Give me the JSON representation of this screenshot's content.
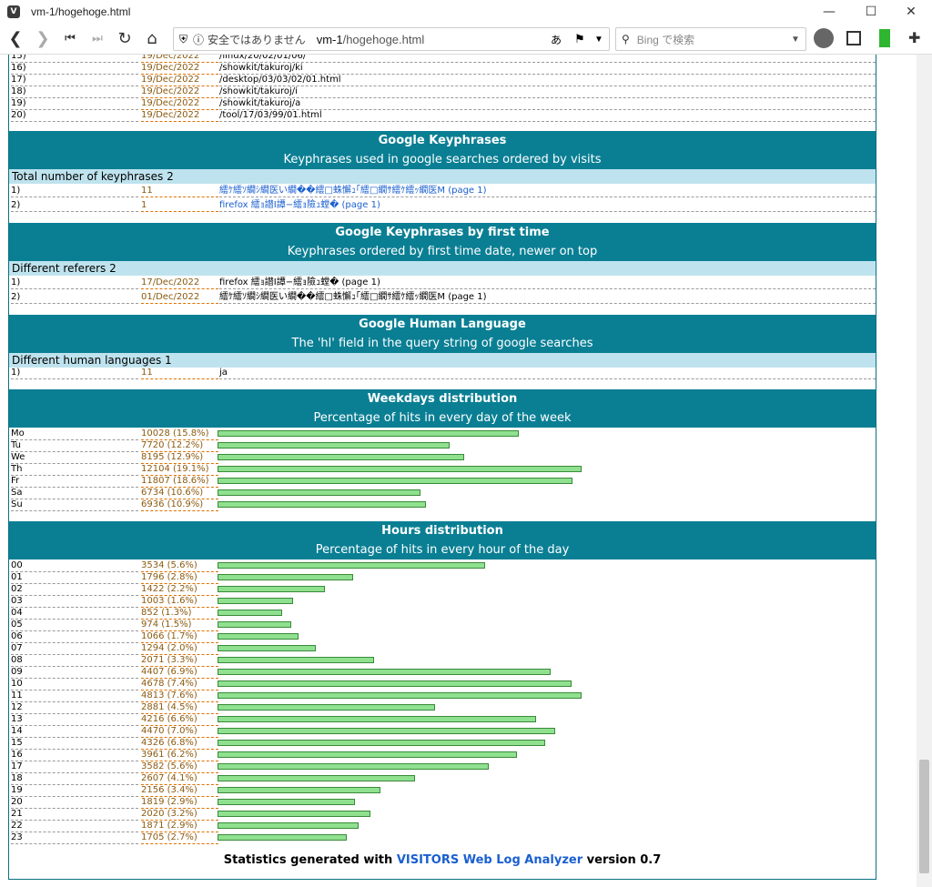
{
  "window": {
    "title": "vm-1/hogehoge.html"
  },
  "address": {
    "security": "安全ではありません",
    "host": "vm-1",
    "path": "/hogehoge.html"
  },
  "search": {
    "placeholder": "Bing で検索"
  },
  "top_rows": [
    {
      "n": "15)",
      "date": "19/Dec/2022",
      "page": "/linux/20/02/01/06/"
    },
    {
      "n": "16)",
      "date": "19/Dec/2022",
      "page": "/showkit/takuroj/ki"
    },
    {
      "n": "17)",
      "date": "19/Dec/2022",
      "page": "/desktop/03/03/02/01.html"
    },
    {
      "n": "18)",
      "date": "19/Dec/2022",
      "page": "/showkit/takuroj/i"
    },
    {
      "n": "19)",
      "date": "19/Dec/2022",
      "page": "/showkit/takuroj/a"
    },
    {
      "n": "20)",
      "date": "19/Dec/2022",
      "page": "/tool/17/03/99/01.html"
    }
  ],
  "keyphrases": {
    "title": "Google Keyphrases",
    "subtitle": "Keyphrases used in google searches ordered by visits",
    "total": "Total number of keyphrases 2",
    "rows": [
      {
        "n": "1)",
        "count": "11",
        "phrase": "繧ｹ繧ｿ繝ｼ繝医い繝��繧□蛛懈ｭ｢繧□繝ｻ繧ｹ繧ｯ繝医M (page 1)"
      },
      {
        "n": "2)",
        "count": "1",
        "phrase": "firefox 繧ｮ譛I譚−繧ｮ險ｭ螳� (page 1)"
      }
    ]
  },
  "first_time": {
    "title": "Google Keyphrases by first time",
    "subtitle": "Keyphrases ordered by first time date, newer on top",
    "total": "Different referers 2",
    "rows": [
      {
        "n": "1)",
        "date": "17/Dec/2022",
        "phrase": "firefox 繧ｮ譛I譚−繧ｮ險ｭ螳� (page 1)"
      },
      {
        "n": "2)",
        "date": "01/Dec/2022",
        "phrase": "繧ｹ繧ｿ繝ｼ繝医い繝��繧□蛛懈ｭ｢繧□繝ｻ繧ｹ繧ｯ繝医M (page 1)"
      }
    ]
  },
  "language": {
    "title": "Google Human Language",
    "subtitle": "The 'hl' field in the query string of google searches",
    "total": "Different human languages 1",
    "rows": [
      {
        "n": "1)",
        "count": "11",
        "lang": "ja"
      }
    ]
  },
  "weekdays": {
    "title": "Weekdays distribution",
    "subtitle": "Percentage of hits in every day of the week",
    "rows": [
      {
        "day": "Mo",
        "hits": 10028,
        "pct": "15.8%",
        "label": "10028 (15.8%)"
      },
      {
        "day": "Tu",
        "hits": 7720,
        "pct": "12.2%",
        "label": "7720 (12.2%)"
      },
      {
        "day": "We",
        "hits": 8195,
        "pct": "12.9%",
        "label": "8195 (12.9%)"
      },
      {
        "day": "Th",
        "hits": 12104,
        "pct": "19.1%",
        "label": "12104 (19.1%)"
      },
      {
        "day": "Fr",
        "hits": 11807,
        "pct": "18.6%",
        "label": "11807 (18.6%)"
      },
      {
        "day": "Sa",
        "hits": 6734,
        "pct": "10.6%",
        "label": "6734 (10.6%)"
      },
      {
        "day": "Su",
        "hits": 6936,
        "pct": "10.9%",
        "label": "6936 (10.9%)"
      }
    ]
  },
  "hours": {
    "title": "Hours distribution",
    "subtitle": "Percentage of hits in every hour of the day",
    "rows": [
      {
        "hour": "00",
        "hits": 3534,
        "label": "3534 (5.6%)"
      },
      {
        "hour": "01",
        "hits": 1796,
        "label": "1796 (2.8%)"
      },
      {
        "hour": "02",
        "hits": 1422,
        "label": "1422 (2.2%)"
      },
      {
        "hour": "03",
        "hits": 1003,
        "label": "1003 (1.6%)"
      },
      {
        "hour": "04",
        "hits": 852,
        "label": "852 (1.3%)"
      },
      {
        "hour": "05",
        "hits": 974,
        "label": "974 (1.5%)"
      },
      {
        "hour": "06",
        "hits": 1066,
        "label": "1066 (1.7%)"
      },
      {
        "hour": "07",
        "hits": 1294,
        "label": "1294 (2.0%)"
      },
      {
        "hour": "08",
        "hits": 2071,
        "label": "2071 (3.3%)"
      },
      {
        "hour": "09",
        "hits": 4407,
        "label": "4407 (6.9%)"
      },
      {
        "hour": "10",
        "hits": 4678,
        "label": "4678 (7.4%)"
      },
      {
        "hour": "11",
        "hits": 4813,
        "label": "4813 (7.6%)"
      },
      {
        "hour": "12",
        "hits": 2881,
        "label": "2881 (4.5%)"
      },
      {
        "hour": "13",
        "hits": 4216,
        "label": "4216 (6.6%)"
      },
      {
        "hour": "14",
        "hits": 4470,
        "label": "4470 (7.0%)"
      },
      {
        "hour": "15",
        "hits": 4326,
        "label": "4326 (6.8%)"
      },
      {
        "hour": "16",
        "hits": 3961,
        "label": "3961 (6.2%)"
      },
      {
        "hour": "17",
        "hits": 3582,
        "label": "3582 (5.6%)"
      },
      {
        "hour": "18",
        "hits": 2607,
        "label": "2607 (4.1%)"
      },
      {
        "hour": "19",
        "hits": 2156,
        "label": "2156 (3.4%)"
      },
      {
        "hour": "20",
        "hits": 1819,
        "label": "1819 (2.9%)"
      },
      {
        "hour": "21",
        "hits": 2020,
        "label": "2020 (3.2%)"
      },
      {
        "hour": "22",
        "hits": 1871,
        "label": "1871 (2.9%)"
      },
      {
        "hour": "23",
        "hits": 1705,
        "label": "1705 (2.7%)"
      }
    ]
  },
  "footer": {
    "prefix": "Statistics generated with",
    "link": "VISITORS Web Log Analyzer",
    "suffix": "version 0.7"
  },
  "colors": {
    "header": "#0a7f94",
    "subheader": "#bfe3ee",
    "bar": "#8fe08f",
    "link": "#1a5fd0"
  }
}
